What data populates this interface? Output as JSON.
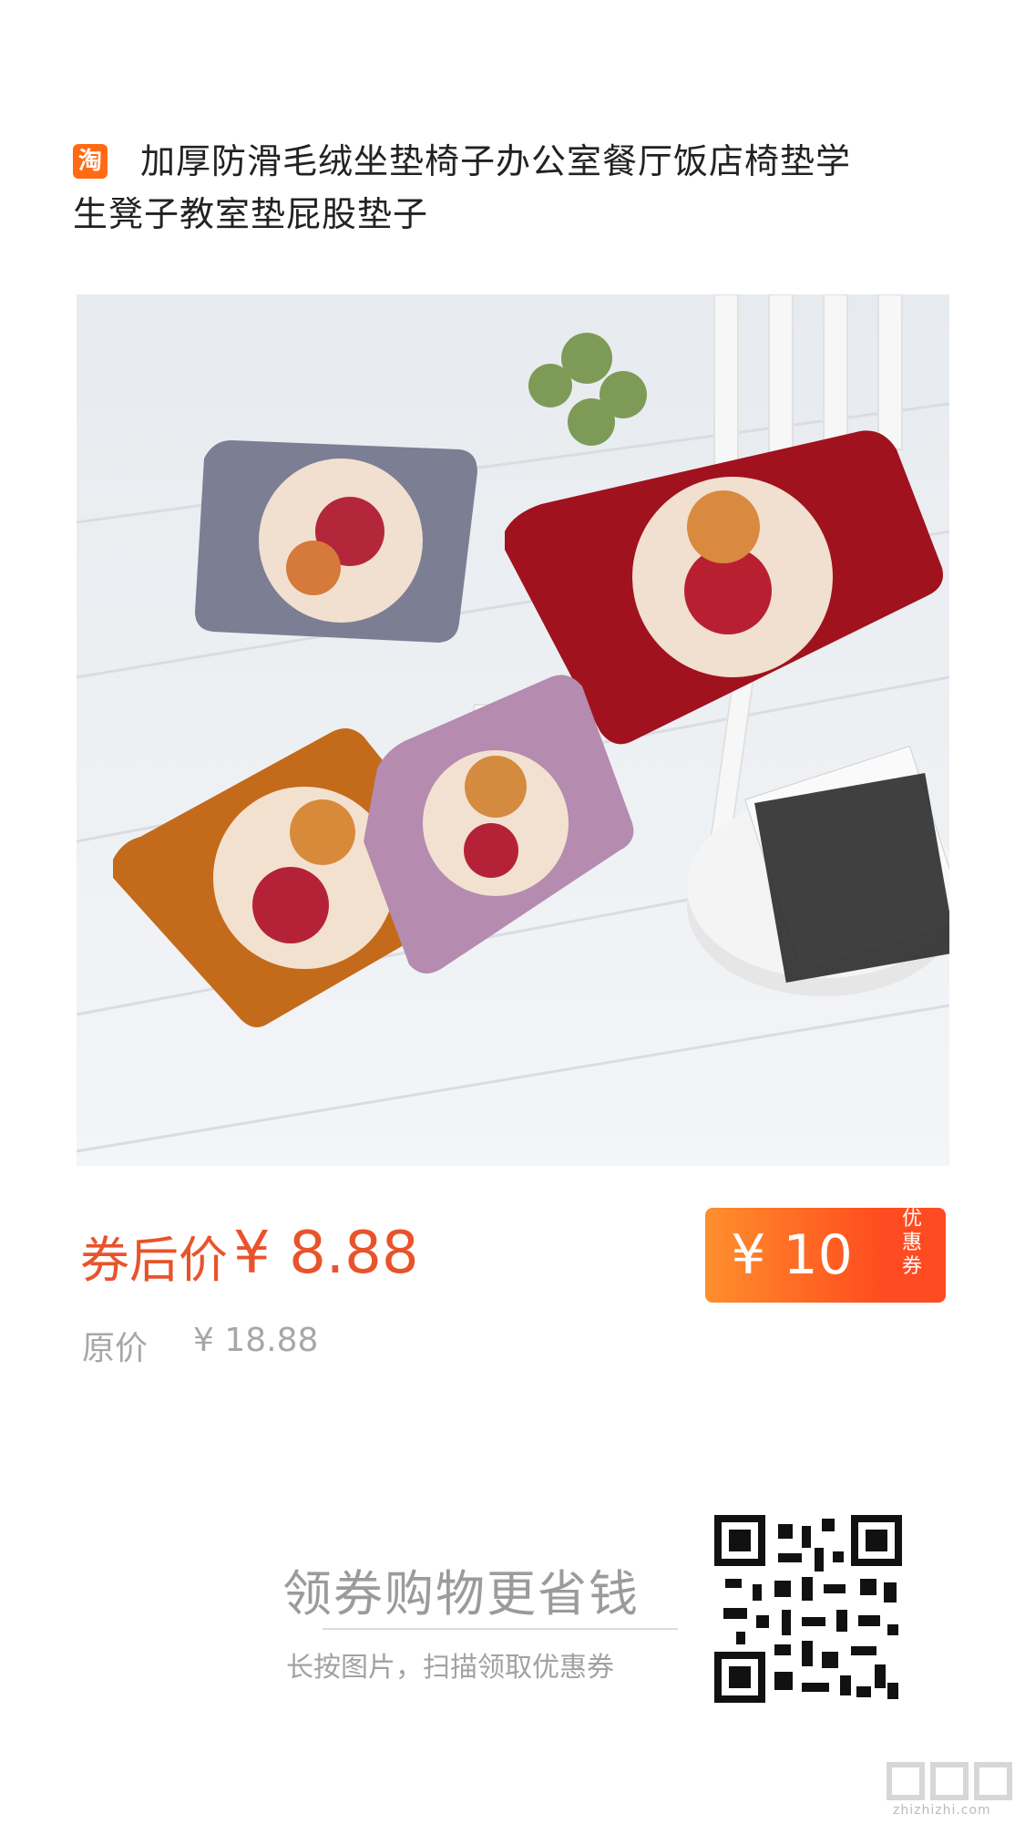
{
  "title": {
    "platform_badge": "淘",
    "line1": "加厚防滑毛绒坐垫椅子办公室餐厅饭店椅垫学",
    "line2": "生凳子教室垫屁股垫子"
  },
  "price": {
    "label": "券后价",
    "currency": "¥",
    "value": "8.88",
    "original_label": "原价",
    "original_value": "¥  18.88"
  },
  "coupon": {
    "amount": "¥ 10",
    "side_text_1": "优",
    "side_text_2": "惠",
    "side_text_3": "券"
  },
  "cta": {
    "title": "领券购物更省钱",
    "subtitle": "长按图片，扫描领取优惠券"
  },
  "watermark": {
    "text": "zhizhizhi.com"
  },
  "colors": {
    "accent": "#e9532b",
    "coupon_start": "#ff8f2d",
    "coupon_end": "#ff4d1e"
  }
}
